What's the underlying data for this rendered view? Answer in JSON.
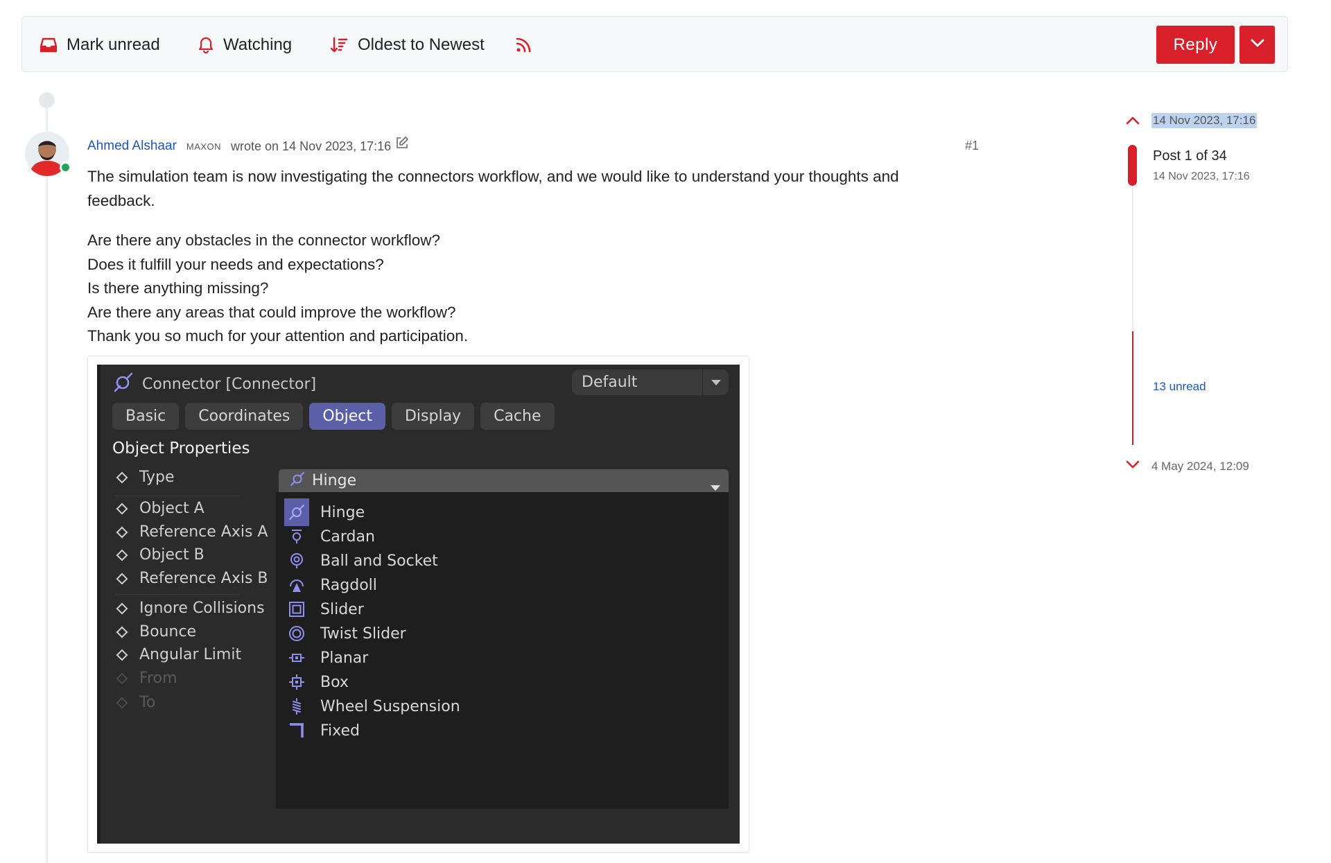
{
  "toolbar": {
    "mark_unread": "Mark unread",
    "watching": "Watching",
    "sort": "Oldest to Newest",
    "reply": "Reply",
    "accent_color": "#d8202b"
  },
  "post": {
    "author": "Ahmed Alshaar",
    "badge": "MAXON",
    "wrote": "wrote on 14 Nov 2023, 17:16",
    "number": "#1",
    "paragraph1": "The simulation team is now investigating the connectors workflow, and we would like to understand your thoughts and feedback.",
    "lines": [
      "Are there any obstacles in the connector workflow?",
      "Does it fulfill your needs and expectations?",
      "Is there anything missing?",
      "Are there any areas that could improve the workflow?",
      "Thank you so much for your attention and participation."
    ]
  },
  "screenshot": {
    "title": "Connector [Connector]",
    "preset": "Default",
    "tabs": [
      "Basic",
      "Coordinates",
      "Object",
      "Display",
      "Cache"
    ],
    "active_tab": "Object",
    "section": "Object Properties",
    "type_label": "Type",
    "type_value": "Hinge",
    "properties": [
      "Object A",
      "Reference Axis A",
      "Object B",
      "Reference Axis B",
      "Ignore Collisions",
      "Bounce",
      "Angular Limit",
      "From",
      "To"
    ],
    "menu_items": [
      "Hinge",
      "Cardan",
      "Ball and Socket",
      "Ragdoll",
      "Slider",
      "Twist Slider",
      "Planar",
      "Box",
      "Wheel Suspension",
      "Fixed"
    ],
    "selected": "Hinge"
  },
  "scroller": {
    "top_date": "14 Nov 2023, 17:16",
    "post_position": "Post 1 of 34",
    "post_date": "14 Nov 2023, 17:16",
    "unread": "13 unread",
    "bottom_date": "4 May 2024, 12:09"
  }
}
